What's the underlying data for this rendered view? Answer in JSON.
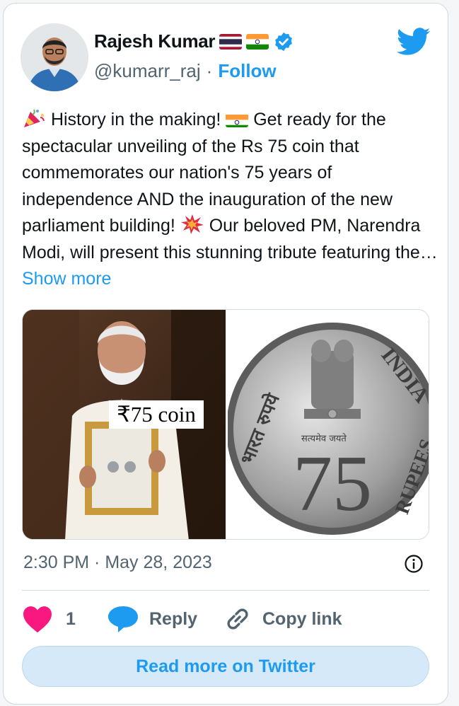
{
  "author": {
    "name": "Rajesh Kumar",
    "handle": "@kumarr_raj",
    "separator": "·",
    "follow_label": "Follow"
  },
  "tweet": {
    "text_part1": " History in the making! ",
    "text_part2": " Get ready for the spectacular unveiling of the Rs 75 coin that commemorates our nation's 75 years of independence AND the inauguration of the new parliament building! ",
    "text_part3": " Our beloved PM, Narendra Modi, will present this stunning tribute featuring the… ",
    "show_more_label": "Show more"
  },
  "media": {
    "left_caption": "₹75 coin",
    "coin_text_top": "INDIA",
    "coin_text_right": "RUPEES",
    "coin_value": "75",
    "coin_text_left": "भारत रुपये",
    "coin_motto": "सत्यमेव जयते"
  },
  "meta": {
    "timestamp": "2:30 PM · May 28, 2023"
  },
  "actions": {
    "like_count": "1",
    "reply_label": "Reply",
    "copy_link_label": "Copy link"
  },
  "footer": {
    "read_more_label": "Read more on Twitter"
  },
  "colors": {
    "accent": "#1d9bf0",
    "like": "#f91880",
    "muted": "#536471"
  },
  "icons": [
    "twitter-bird-icon",
    "verified-badge-icon",
    "party-popper-icon",
    "india-flag-icon",
    "collision-icon",
    "info-icon",
    "heart-icon",
    "reply-bubble-icon",
    "link-icon"
  ]
}
